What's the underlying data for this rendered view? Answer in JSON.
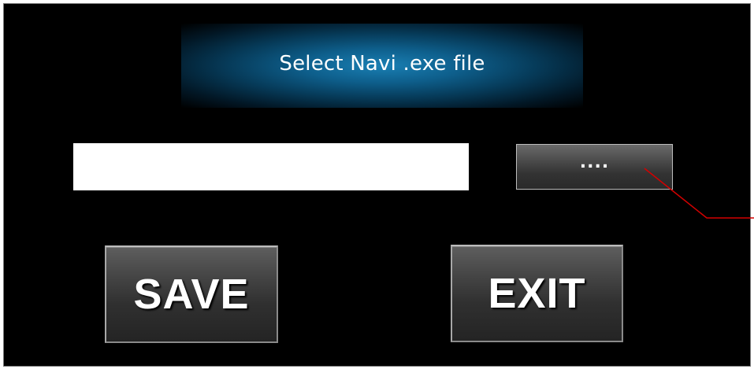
{
  "dialog": {
    "title": "Select Navi .exe file"
  },
  "file_path": {
    "value": "",
    "placeholder": ""
  },
  "browse_button": {
    "label": "...."
  },
  "actions": {
    "save_label": "SAVE",
    "exit_label": "EXIT"
  },
  "colors": {
    "background": "#000000",
    "title_glow": "#1a7fb3",
    "button_face": "#464646",
    "annotation_line": "#d40000"
  }
}
